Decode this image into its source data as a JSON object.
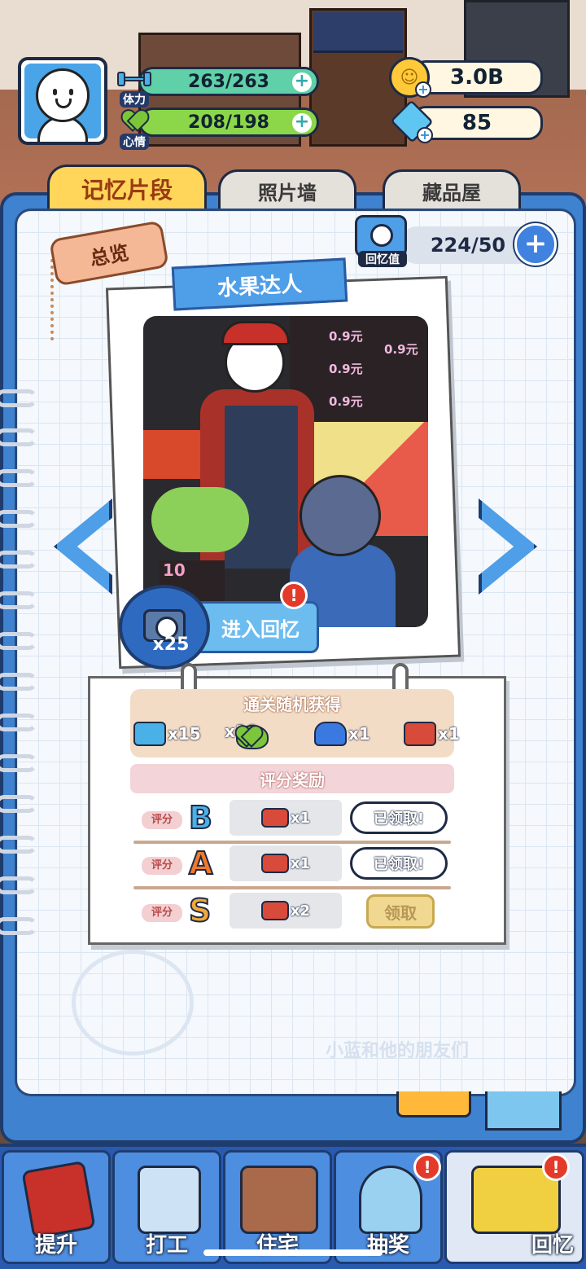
{
  "hud": {
    "energy": {
      "label": "体力",
      "value": "263/263"
    },
    "mood": {
      "label": "心情",
      "value": "208/198"
    },
    "coins": "3.0B",
    "gems": "85"
  },
  "tabs": [
    {
      "label": "记忆片段",
      "active": true
    },
    {
      "label": "照片墙",
      "active": false
    },
    {
      "label": "藏品屋",
      "active": false
    }
  ],
  "overview_tag": "总览",
  "memory_value": {
    "label": "回忆值",
    "value": "224/50"
  },
  "memory": {
    "title": "水果达人",
    "cost": "x25",
    "enter_label": "进入回忆",
    "photo_prices": [
      "0.9元",
      "0.9元",
      "0.9元",
      "0.9元"
    ],
    "photo_sign": "10"
  },
  "rewards": {
    "header": "通关随机获得",
    "items": [
      {
        "icon": "dumbbell-icon",
        "count": "x15"
      },
      {
        "icon": "heart-icon",
        "count": "x10"
      },
      {
        "icon": "car-icon",
        "count": "x1"
      },
      {
        "icon": "brick-icon",
        "count": "x1"
      }
    ],
    "score_header": "评分奖励",
    "score_label": "评分",
    "rows": [
      {
        "grade": "B",
        "reward": "x1",
        "status": "已领取!"
      },
      {
        "grade": "A",
        "reward": "x1",
        "status": "已领取!"
      },
      {
        "grade": "S",
        "reward": "x2",
        "status": "领取"
      }
    ]
  },
  "watermark": "小蓝和他的朋友们",
  "nav": [
    {
      "label": "提升"
    },
    {
      "label": "打工"
    },
    {
      "label": "住宅"
    },
    {
      "label": "抽奖"
    },
    {
      "label": "回忆"
    }
  ],
  "colors": {
    "accent": "#4e9ee8",
    "tab_active": "#ffd65a",
    "alert": "#e43a2a"
  }
}
